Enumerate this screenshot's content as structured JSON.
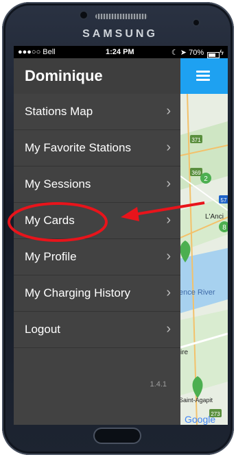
{
  "device": {
    "brand": "SAMSUNG"
  },
  "status_bar": {
    "carrier": "●●●○○ Bell",
    "time": "1:24 PM",
    "right": "70%"
  },
  "drawer": {
    "user_name": "Dominique",
    "items": [
      {
        "label": "Stations Map"
      },
      {
        "label": "My Favorite Stations"
      },
      {
        "label": "My Sessions"
      },
      {
        "label": "My Cards"
      },
      {
        "label": "My Profile"
      },
      {
        "label": "My Charging History"
      },
      {
        "label": "Logout"
      }
    ],
    "chevron": "›",
    "version": "1.4.1"
  },
  "map": {
    "labels": [
      "371",
      "369",
      "2",
      "57",
      "L'Anci",
      "8",
      "ence River",
      "ire",
      "Saint-Agapit",
      "273",
      "Google"
    ]
  },
  "annotation": {
    "color": "#e8141b"
  },
  "colors": {
    "accent": "#1ea1f1",
    "drawer_bg": "#424242",
    "marker": "#4caf50"
  }
}
